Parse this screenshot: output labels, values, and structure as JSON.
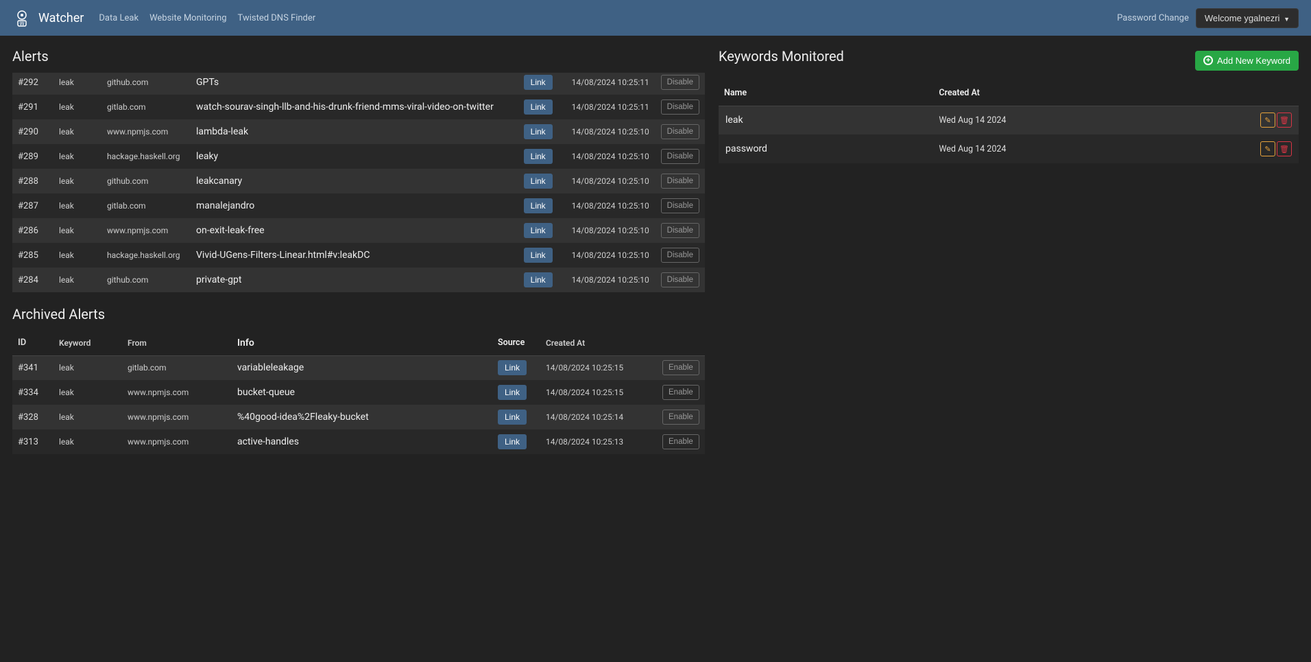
{
  "navbar": {
    "brand": "Watcher",
    "links": [
      "Data Leak",
      "Website Monitoring",
      "Twisted DNS Finder"
    ],
    "password_change": "Password Change",
    "welcome": "Welcome ygalnezri"
  },
  "alerts": {
    "title": "Alerts",
    "link_label": "Link",
    "disable_label": "Disable",
    "rows": [
      {
        "id": "#292",
        "keyword": "leak",
        "from": "github.com",
        "info": "GPTs",
        "date": "14/08/2024 10:25:11"
      },
      {
        "id": "#291",
        "keyword": "leak",
        "from": "gitlab.com",
        "info": "watch-sourav-singh-llb-and-his-drunk-friend-mms-viral-video-on-twitter",
        "date": "14/08/2024 10:25:11"
      },
      {
        "id": "#290",
        "keyword": "leak",
        "from": "www.npmjs.com",
        "info": "lambda-leak",
        "date": "14/08/2024 10:25:10"
      },
      {
        "id": "#289",
        "keyword": "leak",
        "from": "hackage.haskell.org",
        "info": "leaky",
        "date": "14/08/2024 10:25:10"
      },
      {
        "id": "#288",
        "keyword": "leak",
        "from": "github.com",
        "info": "leakcanary",
        "date": "14/08/2024 10:25:10"
      },
      {
        "id": "#287",
        "keyword": "leak",
        "from": "gitlab.com",
        "info": "manalejandro",
        "date": "14/08/2024 10:25:10"
      },
      {
        "id": "#286",
        "keyword": "leak",
        "from": "www.npmjs.com",
        "info": "on-exit-leak-free",
        "date": "14/08/2024 10:25:10"
      },
      {
        "id": "#285",
        "keyword": "leak",
        "from": "hackage.haskell.org",
        "info": "Vivid-UGens-Filters-Linear.html#v:leakDC",
        "date": "14/08/2024 10:25:10"
      },
      {
        "id": "#284",
        "keyword": "leak",
        "from": "github.com",
        "info": "private-gpt",
        "date": "14/08/2024 10:25:10"
      }
    ]
  },
  "archived": {
    "title": "Archived Alerts",
    "headers": {
      "id": "ID",
      "keyword": "Keyword",
      "from": "From",
      "info": "Info",
      "source": "Source",
      "created": "Created At"
    },
    "link_label": "Link",
    "enable_label": "Enable",
    "rows": [
      {
        "id": "#341",
        "keyword": "leak",
        "from": "gitlab.com",
        "info": "variableleakage",
        "date": "14/08/2024 10:25:15"
      },
      {
        "id": "#334",
        "keyword": "leak",
        "from": "www.npmjs.com",
        "info": "bucket-queue",
        "date": "14/08/2024 10:25:15"
      },
      {
        "id": "#328",
        "keyword": "leak",
        "from": "www.npmjs.com",
        "info": "%40good-idea%2Fleaky-bucket",
        "date": "14/08/2024 10:25:14"
      },
      {
        "id": "#313",
        "keyword": "leak",
        "from": "www.npmjs.com",
        "info": "active-handles",
        "date": "14/08/2024 10:25:13"
      }
    ]
  },
  "keywords": {
    "title": "Keywords Monitored",
    "add_label": "Add New Keyword",
    "headers": {
      "name": "Name",
      "created": "Created At"
    },
    "rows": [
      {
        "name": "leak",
        "date": "Wed Aug 14 2024"
      },
      {
        "name": "password",
        "date": "Wed Aug 14 2024"
      }
    ]
  }
}
